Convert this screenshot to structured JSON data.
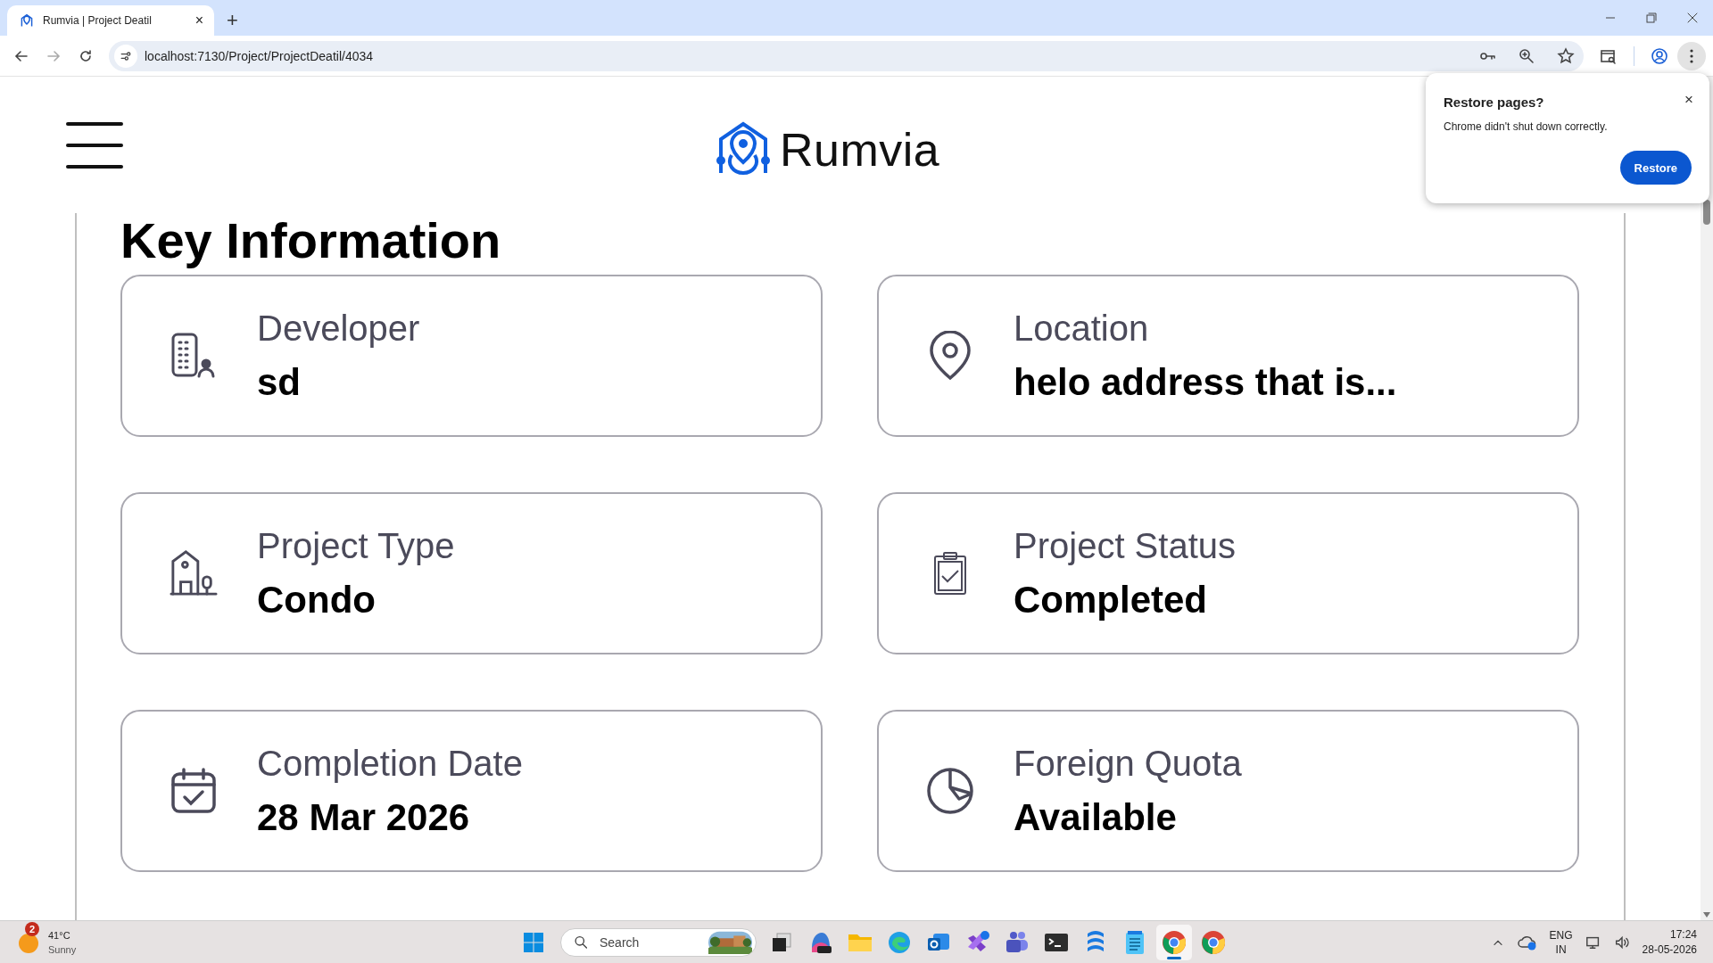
{
  "browser": {
    "tab_title": "Rumvia | Project Deatil",
    "tab_close": "×",
    "new_tab": "+",
    "url": "localhost:7130/Project/ProjectDeatil/4034"
  },
  "header": {
    "logo_text": "Rumvia"
  },
  "section_title": "Key Information",
  "cards": [
    {
      "label": "Developer",
      "value": "sd"
    },
    {
      "label": "Location",
      "value": "helo address that is..."
    },
    {
      "label": "Project Type",
      "value": "Condo"
    },
    {
      "label": "Project Status",
      "value": "Completed"
    },
    {
      "label": "Completion Date",
      "value": "28 Mar 2026"
    },
    {
      "label": "Foreign Quota",
      "value": "Available"
    }
  ],
  "restore_popup": {
    "title": "Restore pages?",
    "message": "Chrome didn't shut down correctly.",
    "button": "Restore",
    "close": "×"
  },
  "taskbar": {
    "weather": {
      "badge": "2",
      "temperature": "41°C",
      "condition": "Sunny"
    },
    "search": {
      "placeholder": "Search"
    },
    "apps": [
      {
        "selected": false
      },
      {
        "selected": false
      },
      {
        "selected": false
      },
      {
        "selected": false
      },
      {
        "selected": false
      },
      {
        "selected": false
      },
      {
        "selected": false
      },
      {
        "selected": false
      },
      {
        "selected": false
      },
      {
        "selected": false
      },
      {
        "selected": true
      },
      {
        "selected": false
      }
    ],
    "language": "ENG",
    "region": "IN",
    "time": "17:24",
    "date": "28-05-2026"
  }
}
